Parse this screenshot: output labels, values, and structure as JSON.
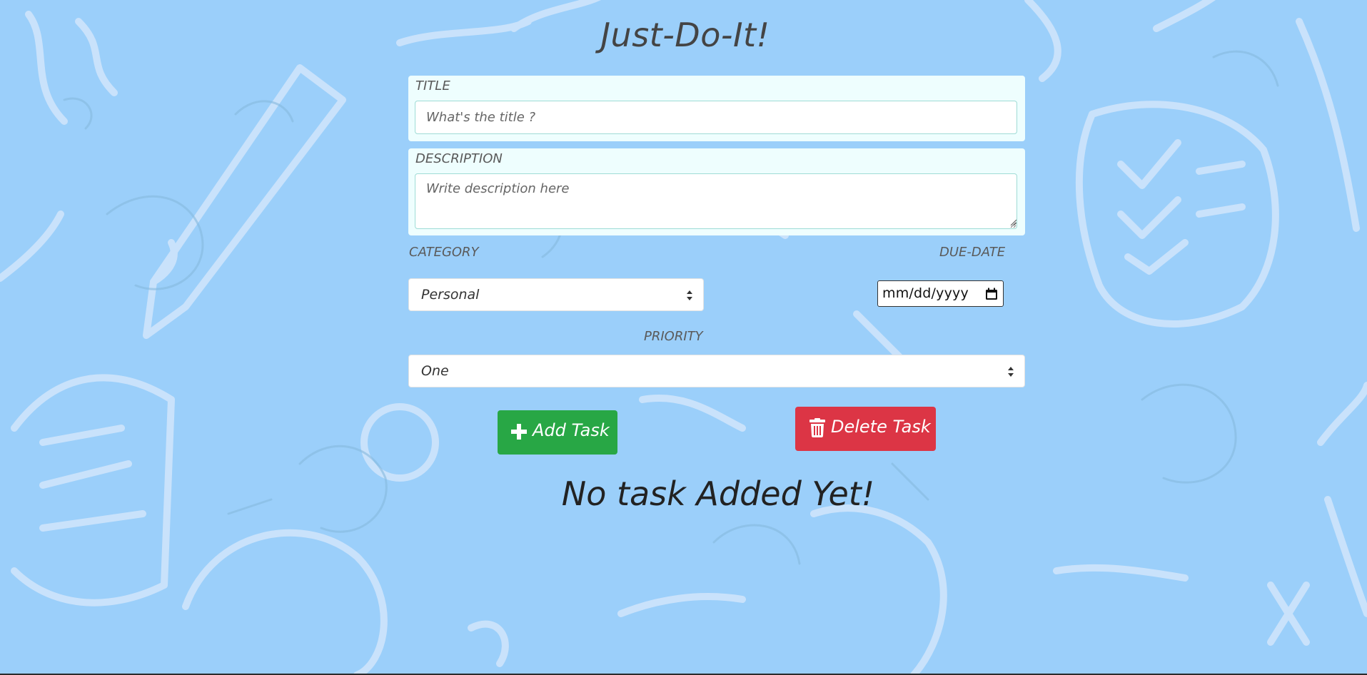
{
  "app": {
    "title": "Just-Do-It!"
  },
  "form": {
    "title_field": {
      "label": "TITLE",
      "placeholder": "What's the title ?",
      "value": ""
    },
    "description_field": {
      "label": "DESCRIPTION",
      "placeholder": "Write description here",
      "value": ""
    },
    "category": {
      "label": "CATEGORY",
      "selected": "Personal"
    },
    "due_date": {
      "label": "DUE-DATE",
      "value": "mm/dd/yyyy"
    },
    "priority": {
      "label": "PRIORITY",
      "selected": "One"
    }
  },
  "actions": {
    "add_label": "Add Task",
    "add_icon": "plus-icon",
    "delete_label": "Delete Task",
    "delete_icon": "trash-icon"
  },
  "tasks": {
    "empty_message": "No task Added Yet!"
  },
  "colors": {
    "background": "#9bcffa",
    "card": "#eefefe",
    "add_button": "#28a745",
    "delete_button": "#dc3545"
  }
}
